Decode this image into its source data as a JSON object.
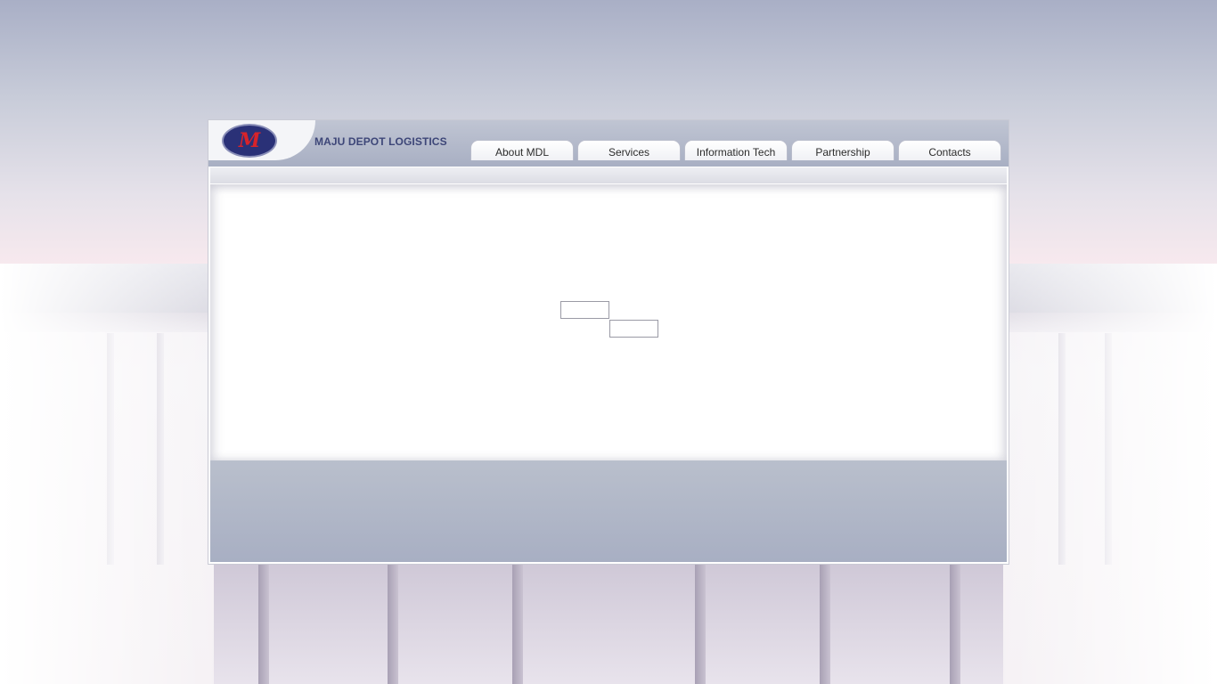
{
  "brand": {
    "logo_mark": "M",
    "name": "MAJU DEPOT LOGISTICS"
  },
  "nav": {
    "items": [
      {
        "label": "About MDL"
      },
      {
        "label": "Services"
      },
      {
        "label": "Information Tech"
      },
      {
        "label": "Partnership"
      },
      {
        "label": "Contacts"
      }
    ]
  },
  "colors": {
    "brand_navy": "#2a3177",
    "brand_red": "#d8232a",
    "header_gray": "#a8afc3"
  },
  "icons": {
    "logo": "company-logo-oval"
  }
}
